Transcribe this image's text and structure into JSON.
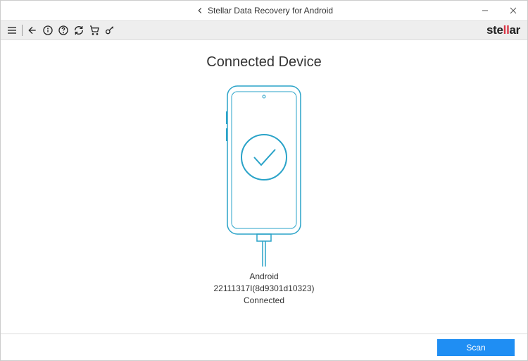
{
  "window": {
    "title": "Stellar Data Recovery for Android"
  },
  "brand": {
    "pre": "ste",
    "accent": "ll",
    "post": "ar"
  },
  "main": {
    "title": "Connected Device",
    "device_name": "Android",
    "device_id": "22111317I(8d9301d10323)",
    "status": "Connected"
  },
  "footer": {
    "scan_label": "Scan"
  },
  "colors": {
    "phone_outline": "#2aa3c8",
    "accent_red": "#d93344",
    "primary_blue": "#1f8ef3"
  }
}
